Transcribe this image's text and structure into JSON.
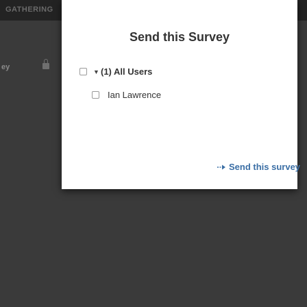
{
  "background": {
    "app_title": "GATHERING",
    "side_text": "ey"
  },
  "modal": {
    "title": "Send this Survey",
    "group": {
      "label": "(1) All Users",
      "expanded": true
    },
    "users": [
      {
        "name": "Ian Lawrence",
        "checked": false
      }
    ],
    "send_button_label": "Send this survey",
    "colors": {
      "link": "#3a6ea5",
      "text": "#333333"
    }
  }
}
